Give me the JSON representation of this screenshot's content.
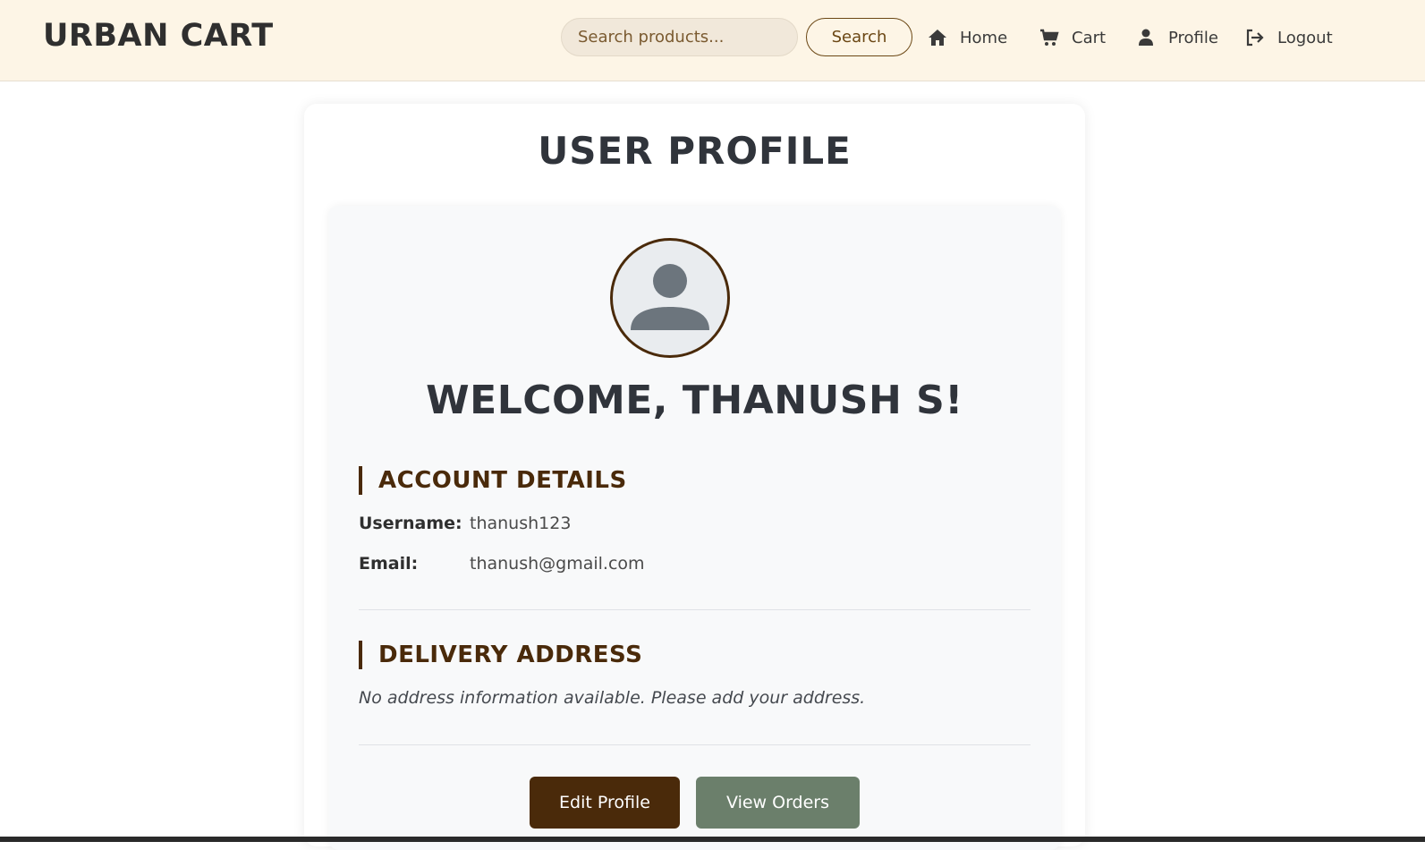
{
  "header": {
    "brand": "URBAN CART",
    "search_placeholder": "Search products...",
    "search_button": "Search",
    "nav": {
      "home": "Home",
      "cart": "Cart",
      "profile": "Profile",
      "logout": "Logout"
    }
  },
  "profile": {
    "title": "USER PROFILE",
    "welcome": "WELCOME, THANUSH S!",
    "account_heading": "ACCOUNT DETAILS",
    "username_label": "Username:",
    "username_value": "thanush123",
    "email_label": "Email:",
    "email_value": "thanush@gmail.com",
    "delivery_heading": "DELIVERY ADDRESS",
    "address_note": "No address information available. Please add your address.",
    "edit_button": "Edit Profile",
    "orders_button": "View Orders"
  },
  "colors": {
    "header_bg": "#fdf5e6",
    "accent_brown": "#4a2a0a",
    "muted_green": "#6b7f6b"
  }
}
